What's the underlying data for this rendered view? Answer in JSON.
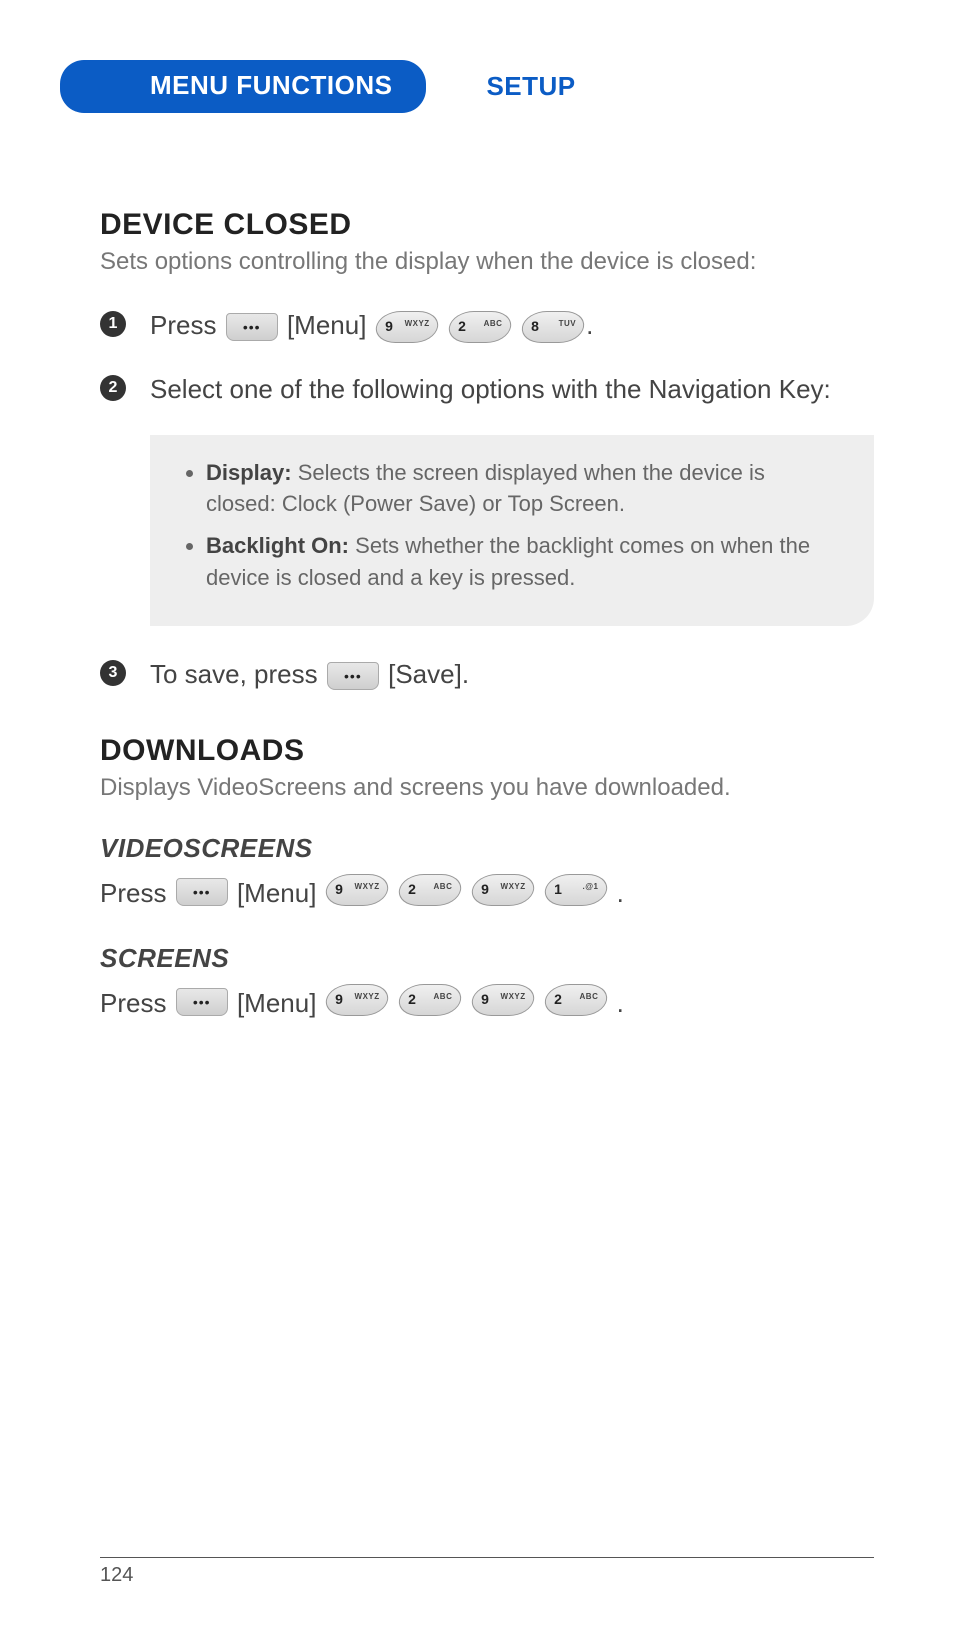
{
  "header": {
    "tab_main": "MENU FUNCTIONS",
    "tab_secondary": "SETUP"
  },
  "section_device_closed": {
    "title": "DEVICE CLOSED",
    "desc": "Sets options controlling the display when the device is closed:",
    "steps": {
      "s1": {
        "num": "1",
        "press": "Press",
        "menu_label": "[Menu]",
        "keys": [
          {
            "main": "9",
            "sub": "WXYZ"
          },
          {
            "main": "2",
            "sub": "ABC"
          },
          {
            "main": "8",
            "sub": "TUV"
          }
        ]
      },
      "s2": {
        "num": "2",
        "text": "Select one of the following options with the Navigation Key:",
        "options": [
          {
            "label": "Display:",
            "desc": "Selects the screen displayed when the device is closed: Clock (Power Save) or Top Screen."
          },
          {
            "label": "Backlight On:",
            "desc": "Sets whether the backlight comes on when the device is closed and a key is pressed."
          }
        ]
      },
      "s3": {
        "num": "3",
        "pre": "To save, press",
        "save_label": "[Save]."
      }
    }
  },
  "section_downloads": {
    "title": "DOWNLOADS",
    "desc": "Displays VideoScreens and screens you have downloaded.",
    "videoscreens": {
      "title": "VIDEOSCREENS",
      "press": "Press",
      "menu_label": "[Menu]",
      "keys": [
        {
          "main": "9",
          "sub": "WXYZ"
        },
        {
          "main": "2",
          "sub": "ABC"
        },
        {
          "main": "9",
          "sub": "WXYZ"
        },
        {
          "main": "1",
          "sub": ".@1"
        }
      ],
      "period": "."
    },
    "screens": {
      "title": "SCREENS",
      "press": "Press",
      "menu_label": "[Menu]",
      "keys": [
        {
          "main": "9",
          "sub": "WXYZ"
        },
        {
          "main": "2",
          "sub": "ABC"
        },
        {
          "main": "9",
          "sub": "WXYZ"
        },
        {
          "main": "2",
          "sub": "ABC"
        }
      ],
      "period": "."
    }
  },
  "footer": {
    "page_number": "124"
  }
}
